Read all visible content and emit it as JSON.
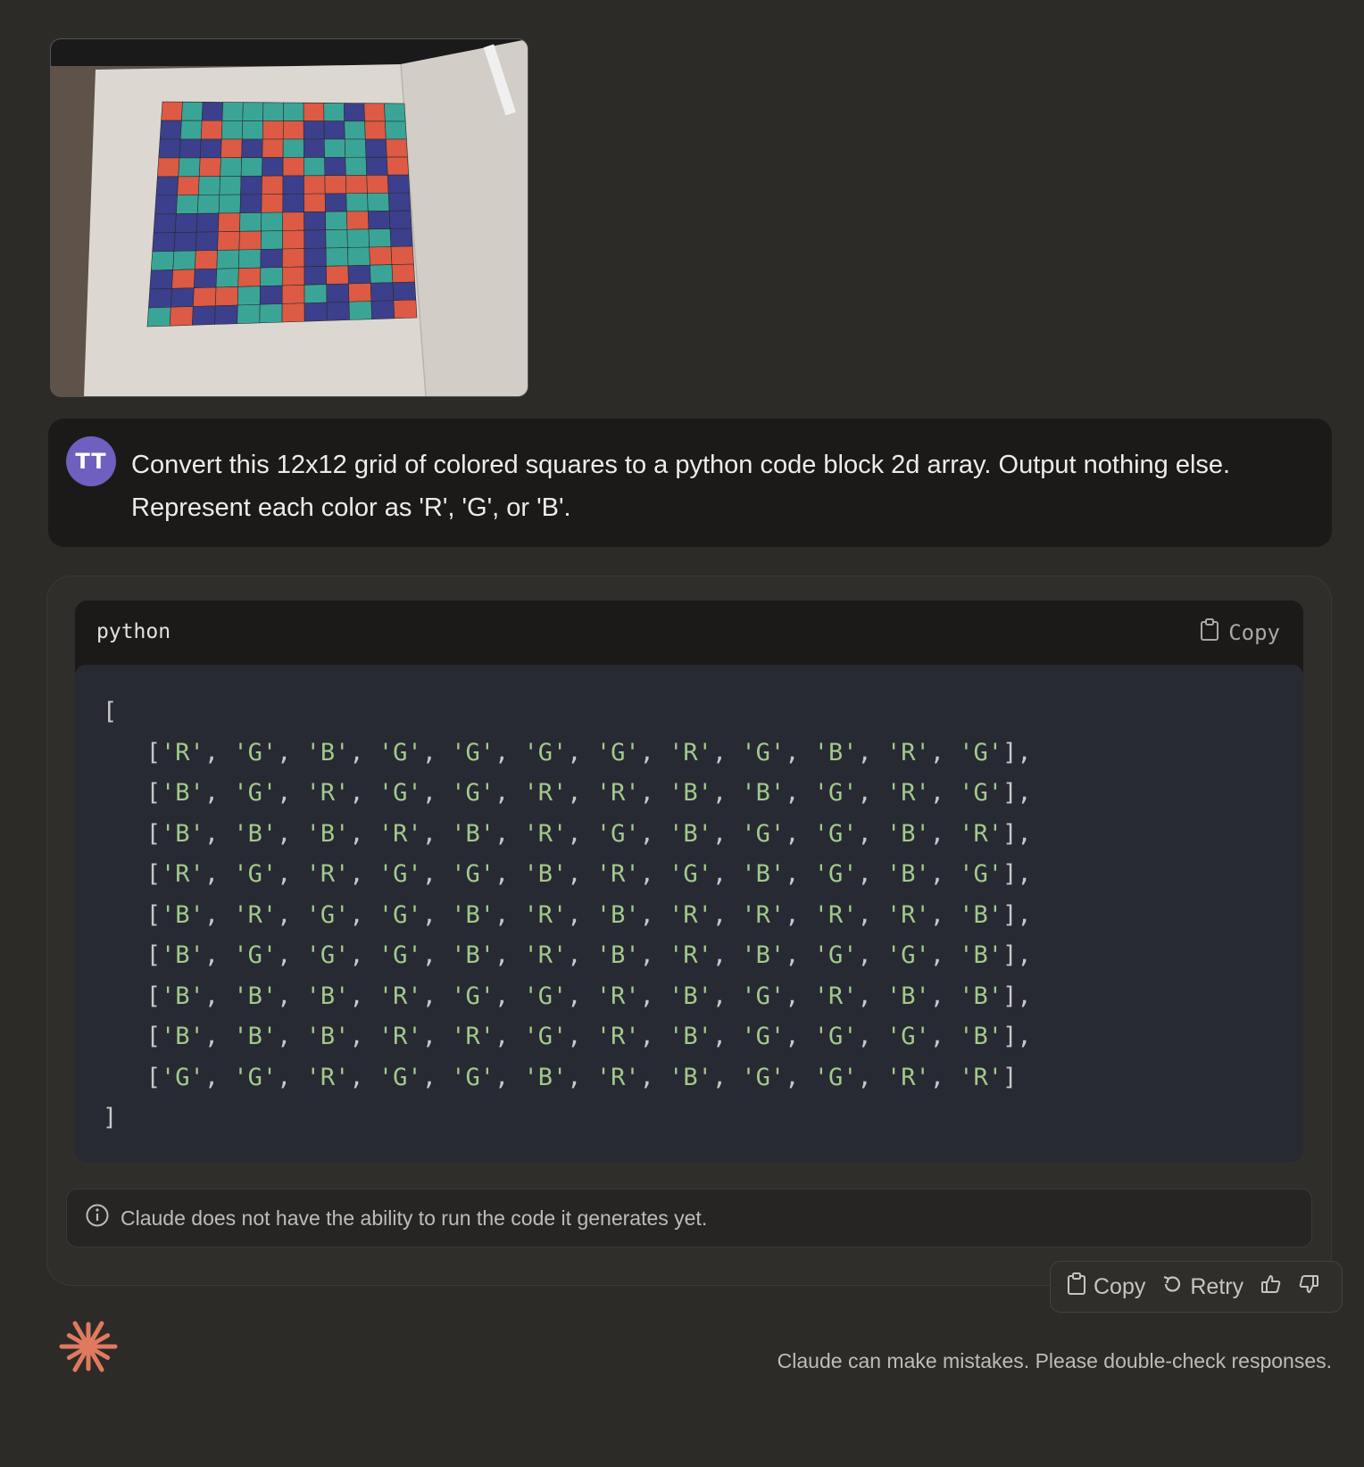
{
  "user": {
    "avatar_initials": "TT",
    "avatar_color": "#6f5fbe",
    "message": "Convert this 12x12 grid of colored squares to a python code block 2d array. Output nothing else. Represent each color as 'R', 'G', or 'B'."
  },
  "attachment": {
    "icon": "photo-thumbnail"
  },
  "reply": {
    "code_language": "python",
    "copy_code_label": "Copy",
    "open_bracket": "[",
    "close_bracket": "]",
    "rows": [
      [
        "R",
        "G",
        "B",
        "G",
        "G",
        "G",
        "G",
        "R",
        "G",
        "B",
        "R",
        "G"
      ],
      [
        "B",
        "G",
        "R",
        "G",
        "G",
        "R",
        "R",
        "B",
        "B",
        "G",
        "R",
        "G"
      ],
      [
        "B",
        "B",
        "B",
        "R",
        "B",
        "R",
        "G",
        "B",
        "G",
        "G",
        "B",
        "R"
      ],
      [
        "R",
        "G",
        "R",
        "G",
        "G",
        "B",
        "R",
        "G",
        "B",
        "G",
        "B",
        "G"
      ],
      [
        "B",
        "R",
        "G",
        "G",
        "B",
        "R",
        "B",
        "R",
        "R",
        "R",
        "R",
        "B"
      ],
      [
        "B",
        "G",
        "G",
        "G",
        "B",
        "R",
        "B",
        "R",
        "B",
        "G",
        "G",
        "B"
      ],
      [
        "B",
        "B",
        "B",
        "R",
        "G",
        "G",
        "R",
        "B",
        "G",
        "R",
        "B",
        "B"
      ],
      [
        "B",
        "B",
        "B",
        "R",
        "R",
        "G",
        "R",
        "B",
        "G",
        "G",
        "G",
        "B"
      ],
      [
        "G",
        "G",
        "R",
        "G",
        "G",
        "B",
        "R",
        "B",
        "G",
        "G",
        "R",
        "R"
      ]
    ],
    "note": "Claude does not have the ability to run the code it generates yet.",
    "string_color": "#a2c98a"
  },
  "actions": {
    "copy_label": "Copy",
    "retry_label": "Retry",
    "icons": [
      "clipboard-icon",
      "retry-icon",
      "thumbs-up-icon",
      "thumbs-down-icon"
    ]
  },
  "footer": {
    "disclaimer": "Claude can make mistakes. Please double-check responses.",
    "logo_color": "#e07a5f"
  }
}
